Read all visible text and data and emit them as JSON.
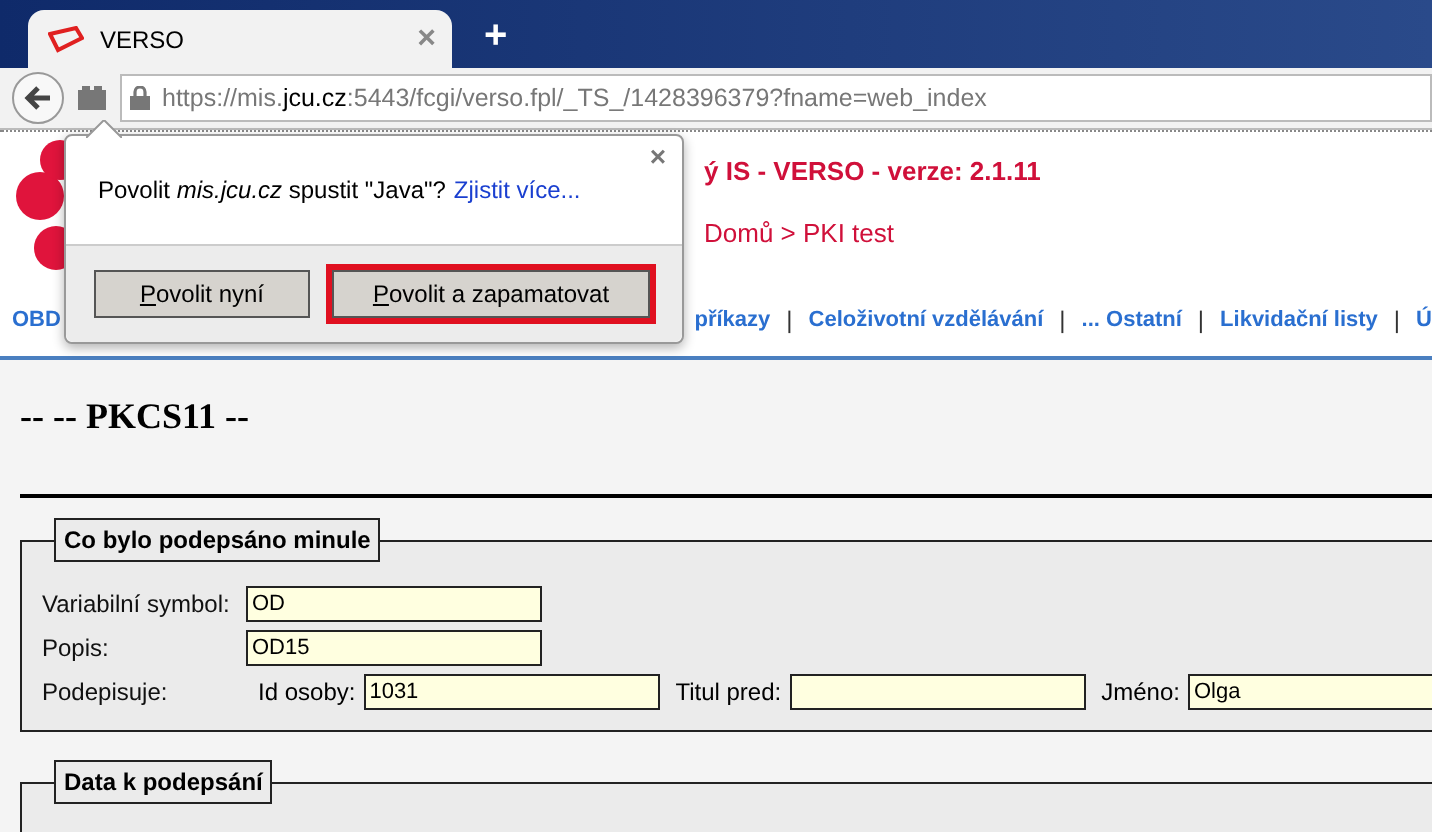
{
  "browser": {
    "tab": {
      "title": "VERSO",
      "close": "×"
    },
    "new_tab": "+",
    "url": {
      "scheme": "https://mis.",
      "domain": "jcu.cz",
      "path": ":5443/fcgi/verso.fpl/_TS_/1428396379?fname=web_index"
    }
  },
  "popup": {
    "message": "Povolit *mis.jcu.cz* spustit \"Java\"?",
    "link": "Zjistit více...",
    "close": "×",
    "buttons": [
      {
        "label": "Povolit nyní",
        "highlighted": false
      },
      {
        "label": "Povolit a zapamatovat",
        "highlighted": true
      }
    ]
  },
  "header": {
    "title": "ý IS - VERSO - verze: 2.1.11",
    "breadcrumb": "Domů > PKI test"
  },
  "nav": [
    {
      "kind": "link",
      "text": "OBD"
    },
    {
      "kind": "gap"
    },
    {
      "kind": "link",
      "text": "příkazy"
    },
    {
      "kind": "separator",
      "text": "|"
    },
    {
      "kind": "link",
      "text": "Celoživotní vzdělávání"
    },
    {
      "kind": "separator",
      "text": "|"
    },
    {
      "kind": "link",
      "text": "... Ostatní"
    },
    {
      "kind": "separator",
      "text": "|"
    },
    {
      "kind": "link",
      "text": "Likvidační listy"
    },
    {
      "kind": "separator",
      "text": "|"
    },
    {
      "kind": "link",
      "text": "Ú"
    }
  ],
  "heading": "-- -- PKCS11 --",
  "sections": [
    {
      "legend": "Co bylo podepsáno minule",
      "rows": [
        {
          "label": "Variabilní symbol:",
          "fields": [
            {
              "value": "OD"
            }
          ]
        },
        {
          "label": "Popis:",
          "fields": [
            {
              "value": "OD15"
            }
          ]
        },
        {
          "label": "Podepisuje:",
          "fields": [
            {
              "label": "Id osoby:",
              "value": "1031"
            },
            {
              "label": "Titul pred:"
            },
            {
              "label": "Jméno:",
              "value": "Olga"
            }
          ]
        }
      ]
    },
    {
      "legend": "Data k podepsání"
    }
  ]
}
